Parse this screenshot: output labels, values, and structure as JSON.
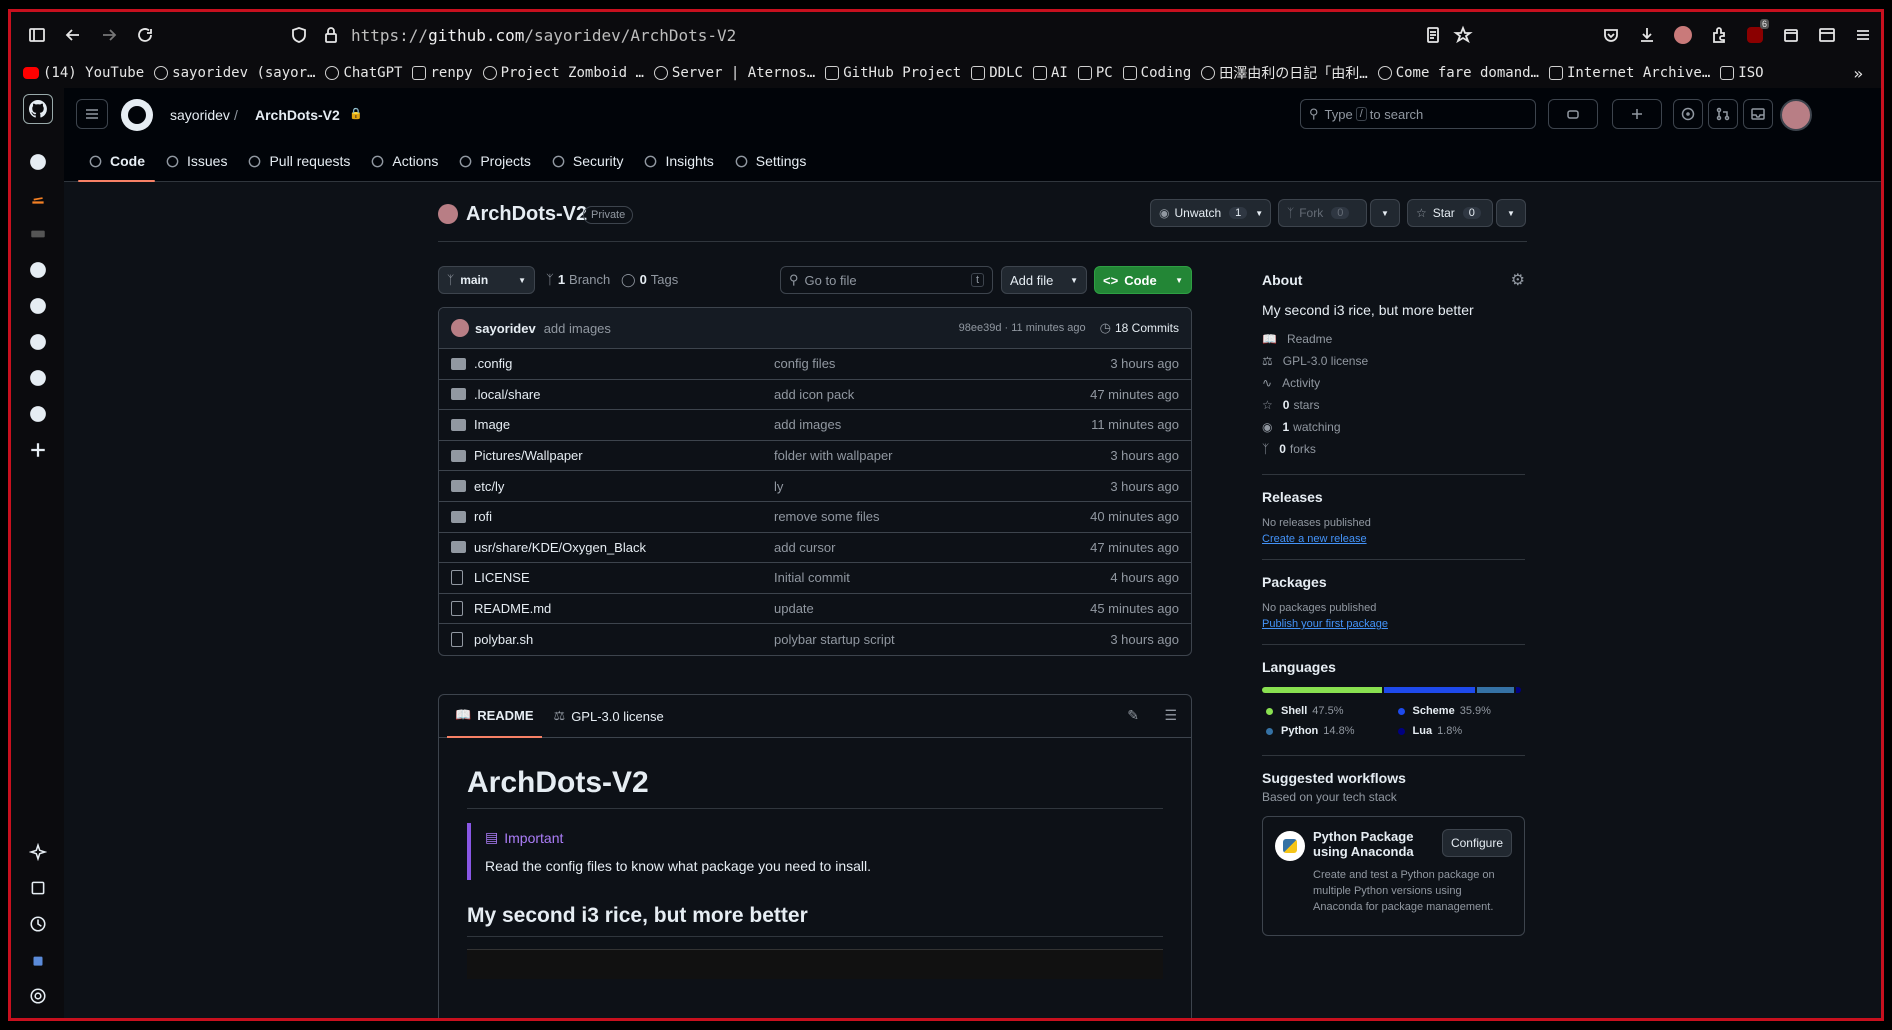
{
  "browser": {
    "url_prefix": "https://",
    "url_host": "github.com",
    "url_path": "/sayoridev/ArchDots-V2",
    "bookmarks": [
      {
        "label": "(14) YouTube",
        "icon": "youtube-icon"
      },
      {
        "label": "sayoridev (sayor…",
        "icon": "github-icon"
      },
      {
        "label": "ChatGPT",
        "icon": "globe-icon"
      },
      {
        "label": "renpy",
        "icon": "folder-icon"
      },
      {
        "label": "Project Zomboid …",
        "icon": "globe-icon"
      },
      {
        "label": "Server | Aternos…",
        "icon": "globe-icon"
      },
      {
        "label": "GitHub Project",
        "icon": "folder-icon"
      },
      {
        "label": "DDLC",
        "icon": "folder-icon"
      },
      {
        "label": "AI",
        "icon": "folder-icon"
      },
      {
        "label": "PC",
        "icon": "folder-icon"
      },
      {
        "label": "Coding",
        "icon": "folder-icon"
      },
      {
        "label": "田澤由利の日記「由利…",
        "icon": "globe-icon"
      },
      {
        "label": "Come fare domand…",
        "icon": "globe-icon"
      },
      {
        "label": "Internet Archive…",
        "icon": "archive-icon"
      },
      {
        "label": "ISO",
        "icon": "folder-icon"
      }
    ],
    "ext_badge": "6"
  },
  "header": {
    "owner": "sayoridev",
    "separator": "/",
    "repo": "ArchDots-V2",
    "search_type": "Type",
    "search_key": "/",
    "search_rest": "to search"
  },
  "nav": {
    "tabs": [
      {
        "label": "Code"
      },
      {
        "label": "Issues"
      },
      {
        "label": "Pull requests"
      },
      {
        "label": "Actions"
      },
      {
        "label": "Projects"
      },
      {
        "label": "Security"
      },
      {
        "label": "Insights"
      },
      {
        "label": "Settings"
      }
    ]
  },
  "repo": {
    "title": "ArchDots-V2",
    "visibility": "Private",
    "unwatch_label": "Unwatch",
    "unwatch_count": "1",
    "fork_label": "Fork",
    "fork_count": "0",
    "star_label": "Star",
    "star_count": "0",
    "branch": "main",
    "branch_count": "1",
    "branch_label": "Branch",
    "tag_count": "0",
    "tag_label": "Tags",
    "goto_placeholder": "Go to file",
    "goto_key": "t",
    "add_file": "Add file",
    "code_button": "Code"
  },
  "commit": {
    "author": "sayoridev",
    "message": "add images",
    "hash_time": "98ee39d · 11 minutes ago",
    "commits": "18 Commits"
  },
  "files": [
    {
      "name": ".config",
      "msg": "config files",
      "time": "3 hours ago",
      "type": "dir"
    },
    {
      "name": ".local/share",
      "msg": "add icon pack",
      "time": "47 minutes ago",
      "type": "dir"
    },
    {
      "name": "Image",
      "msg": "add images",
      "time": "11 minutes ago",
      "type": "dir"
    },
    {
      "name": "Pictures/Wallpaper",
      "msg": "folder with wallpaper",
      "time": "3 hours ago",
      "type": "dir"
    },
    {
      "name": "etc/ly",
      "msg": "ly",
      "time": "3 hours ago",
      "type": "dir"
    },
    {
      "name": "rofi",
      "msg": "remove some files",
      "time": "40 minutes ago",
      "type": "dir"
    },
    {
      "name": "usr/share/KDE/Oxygen_Black",
      "msg": "add cursor",
      "time": "47 minutes ago",
      "type": "dir"
    },
    {
      "name": "LICENSE",
      "msg": "Initial commit",
      "time": "4 hours ago",
      "type": "file"
    },
    {
      "name": "README.md",
      "msg": "update",
      "time": "45 minutes ago",
      "type": "file"
    },
    {
      "name": "polybar.sh",
      "msg": "polybar startup script",
      "time": "3 hours ago",
      "type": "file"
    }
  ],
  "readme": {
    "tab_readme": "README",
    "tab_license": "GPL-3.0 license",
    "h1": "ArchDots-V2",
    "callout_title": "Important",
    "callout_text": "Read the config files to know what package you need to insall.",
    "h2": "My second i3 rice, but more better"
  },
  "about": {
    "title": "About",
    "description": "My second i3 rice, but more better",
    "readme": "Readme",
    "license": "GPL-3.0 license",
    "activity": "Activity",
    "stars_n": "0",
    "stars": "stars",
    "watching_n": "1",
    "watching": "watching",
    "forks_n": "0",
    "forks": "forks"
  },
  "releases": {
    "title": "Releases",
    "none": "No releases published",
    "link": "Create a new release"
  },
  "packages": {
    "title": "Packages",
    "none": "No packages published",
    "link": "Publish your first package"
  },
  "languages": {
    "title": "Languages",
    "items": [
      {
        "name": "Shell",
        "pct": "47.5%",
        "value": 47.5,
        "color": "#89e051"
      },
      {
        "name": "Scheme",
        "pct": "35.9%",
        "value": 35.9,
        "color": "#1e4aec"
      },
      {
        "name": "Python",
        "pct": "14.8%",
        "value": 14.8,
        "color": "#3572A5"
      },
      {
        "name": "Lua",
        "pct": "1.8%",
        "value": 1.8,
        "color": "#000080"
      }
    ]
  },
  "workflows": {
    "title": "Suggested workflows",
    "subtitle": "Based on your tech stack",
    "card_title": "Python Package using Anaconda",
    "card_button": "Configure",
    "card_desc": "Create and test a Python package on multiple Python versions using Anaconda for package management."
  }
}
